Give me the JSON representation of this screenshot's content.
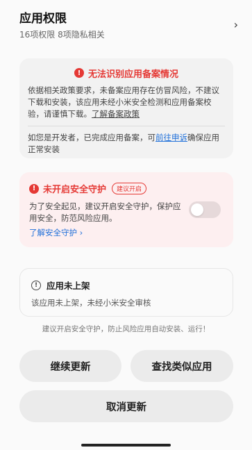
{
  "header": {
    "title": "应用权限",
    "subtitle": "16项权限 8项隐私相关",
    "chevron": "›"
  },
  "warning_card": {
    "icon": "!",
    "title": "无法识别应用备案情况",
    "body": "依据相关政策要求，未备案应用存在仿冒风险，不建议下载和安装，该应用未经小米安全检测和应用备案校验，请谨慎下载。",
    "policy_link": "了解备案政策",
    "dev_text_before": "如您是开发者，已完成应用备案，可",
    "dev_link": "前往申诉",
    "dev_text_after": "确保应用正常安装"
  },
  "security_card": {
    "icon": "!",
    "title": "未开启安全守护",
    "badge": "建议开启",
    "body": "为了安全起见，建议开启安全守护，保护应用安全，防范风险应用。",
    "link": "了解安全守护 ›",
    "toggle_on": false
  },
  "unlisted_card": {
    "icon": "!",
    "title": "应用未上架",
    "body": "该应用未上架，未经小米安全审核"
  },
  "hint": "建议开启安全守护，防止风险应用自动安装、运行！",
  "buttons": {
    "continue": "继续更新",
    "similar": "查找类似应用",
    "cancel": "取消更新"
  },
  "colors": {
    "danger": "#e53935",
    "link": "#1e6fd9"
  }
}
